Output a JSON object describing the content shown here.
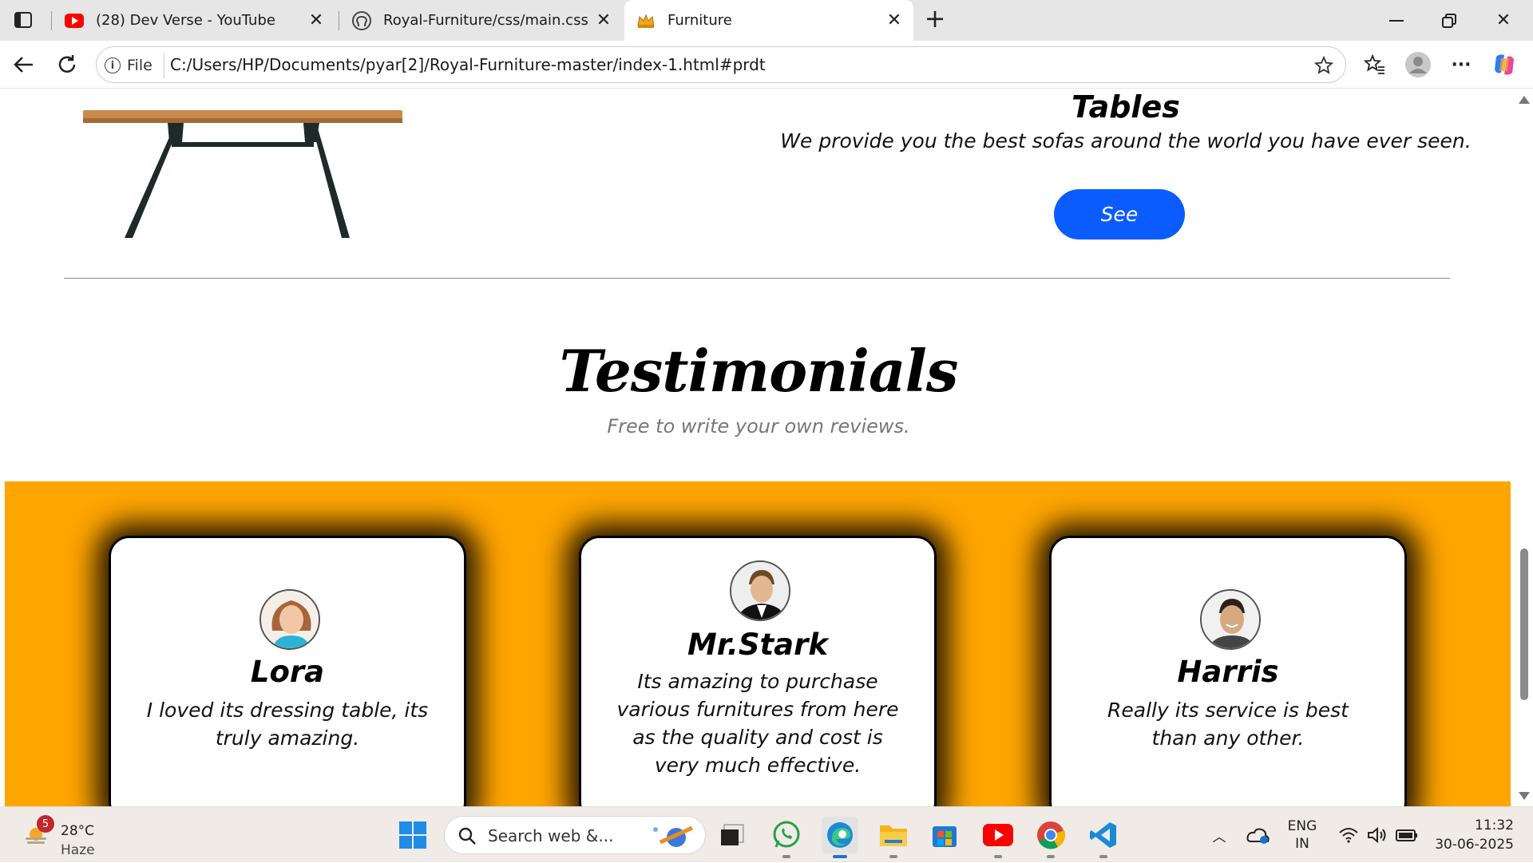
{
  "browser": {
    "tabs": [
      {
        "title": "(28) Dev Verse - YouTube",
        "favicon": "youtube-icon"
      },
      {
        "title": "Royal-Furniture/css/main.css at m",
        "favicon": "github-icon"
      },
      {
        "title": "Furniture",
        "favicon": "crown-icon"
      }
    ],
    "file_label": "File",
    "url": "C:/Users/HP/Documents/pyar[2]/Royal-Furniture-master/index-1.html#prdt"
  },
  "page": {
    "product": {
      "title": "Tables",
      "description": "We provide you the best sofas around the world you have ever seen.",
      "button_label": "See"
    },
    "testimonials": {
      "title": "Testimonials",
      "subtitle": "Free to write your own reviews.",
      "cards": [
        {
          "name": "Lora",
          "text": "I loved its dressing table, its truly amazing."
        },
        {
          "name": "Mr.Stark",
          "text": "Its amazing to purchase various furnitures from here as the quality and cost is very much effective."
        },
        {
          "name": "Harris",
          "text": "Really its service is best than any other."
        }
      ]
    },
    "colors": {
      "accent_band": "#ffa500",
      "button": "#0a5cff"
    }
  },
  "taskbar": {
    "weather_badge": "5",
    "temperature": "28°C",
    "condition": "Haze",
    "search_placeholder": "Search web &...",
    "language_line1": "ENG",
    "language_line2": "IN",
    "time": "11:32",
    "date": "30-06-2025"
  }
}
